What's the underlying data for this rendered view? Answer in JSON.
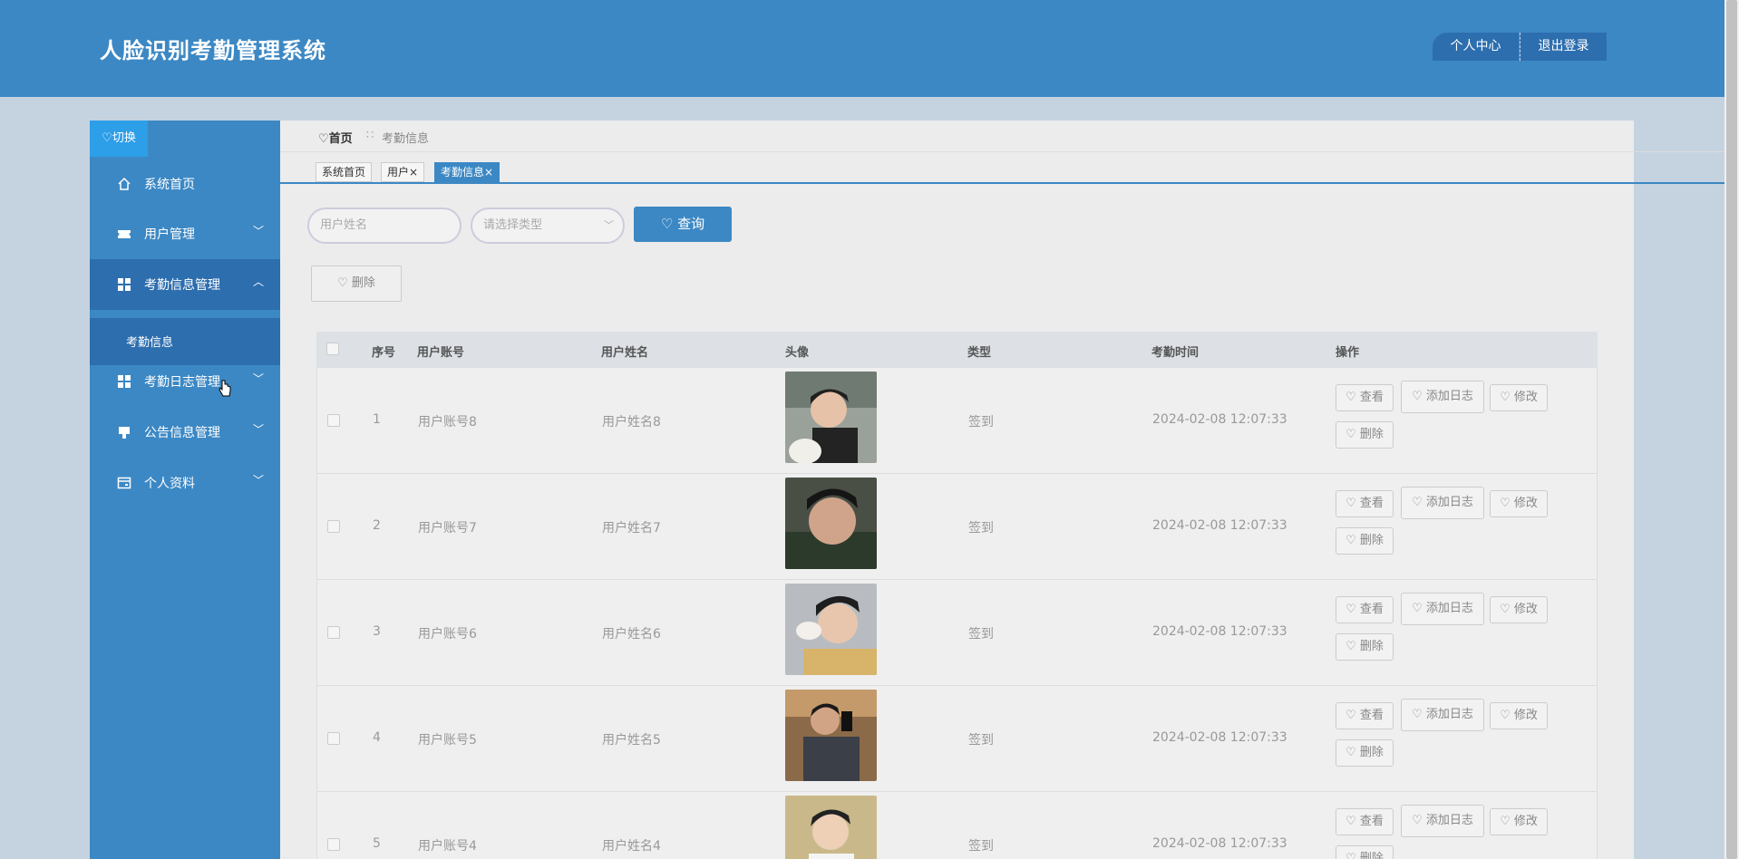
{
  "header": {
    "title": "人脸识别考勤管理系统",
    "personal_center": "个人中心",
    "logout": "退出登录"
  },
  "sidebar": {
    "switch_label": "切换",
    "items": [
      {
        "label": "系统首页",
        "icon": "home-icon"
      },
      {
        "label": "用户管理",
        "icon": "ticket-icon"
      },
      {
        "label": "考勤信息管理",
        "icon": "grid-icon"
      },
      {
        "label": "考勤日志管理",
        "icon": "grid-icon"
      },
      {
        "label": "公告信息管理",
        "icon": "notice-icon"
      },
      {
        "label": "个人资料",
        "icon": "card-icon"
      }
    ],
    "sub_item": "考勤信息"
  },
  "breadcrumb": {
    "home": "首页",
    "sep": "∷",
    "current": "考勤信息"
  },
  "tabs": [
    {
      "label": "系统首页"
    },
    {
      "label": "用户×"
    },
    {
      "label": "考勤信息×"
    }
  ],
  "search": {
    "name_placeholder": "用户姓名",
    "type_placeholder": "请选择类型",
    "query_label": "查询"
  },
  "toolbar": {
    "delete_label": "删除"
  },
  "table": {
    "headers": [
      "序号",
      "用户账号",
      "用户姓名",
      "头像",
      "类型",
      "考勤时间",
      "操作"
    ],
    "rows": [
      {
        "no": "1",
        "account": "用户账号8",
        "name": "用户姓名8",
        "type": "签到",
        "time": "2024-02-08 12:07:33"
      },
      {
        "no": "2",
        "account": "用户账号7",
        "name": "用户姓名7",
        "type": "签到",
        "time": "2024-02-08 12:07:33"
      },
      {
        "no": "3",
        "account": "用户账号6",
        "name": "用户姓名6",
        "type": "签到",
        "time": "2024-02-08 12:07:33"
      },
      {
        "no": "4",
        "account": "用户账号5",
        "name": "用户姓名5",
        "type": "签到",
        "time": "2024-02-08 12:07:33"
      },
      {
        "no": "5",
        "account": "用户账号4",
        "name": "用户姓名4",
        "type": "签到",
        "time": "2024-02-08 12:07:33"
      }
    ],
    "actions": {
      "view": "查看",
      "add_log": "添加日志",
      "edit": "修改",
      "delete": "删除"
    }
  },
  "colors": {
    "header": "#3c88c4",
    "sidebar": "#3c88c4",
    "accent": "#2d6eaf"
  }
}
